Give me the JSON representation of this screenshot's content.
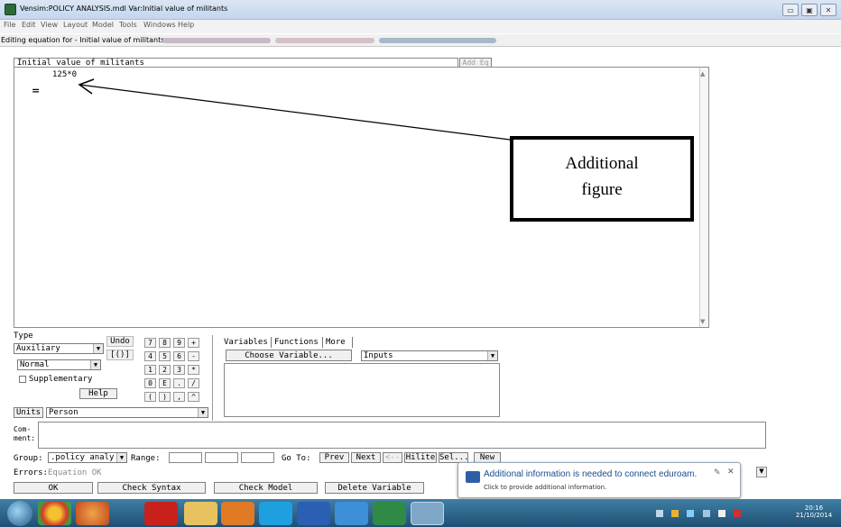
{
  "window": {
    "title": "Vensim:POLICY ANALYSIS.mdl Var:Initial value of militants",
    "controls": [
      "minimize",
      "maximize",
      "close"
    ]
  },
  "menu": [
    "File",
    "Edit",
    "View",
    "Layout",
    "Model",
    "Tools",
    "Windows",
    "Help"
  ],
  "edit_bar": {
    "label": "Editing equation for - Initial value of militants"
  },
  "equation": {
    "variable_name": "Initial value of militants",
    "add_eq_label": "Add Eq",
    "equals_sign": "=",
    "text": "125*0"
  },
  "annotation": {
    "line1": "Additional",
    "line2": "figure"
  },
  "type_panel": {
    "type_label": "Type",
    "type_value": "Auxiliary",
    "subtype_value": "Normal",
    "supplementary_label": "Supplementary",
    "supplementary_checked": false,
    "help_label": "Help",
    "undo_label": "Undo",
    "brackets_label": "[()]"
  },
  "keypad": [
    "7",
    "8",
    "9",
    "+",
    "4",
    "5",
    "6",
    "-",
    "1",
    "2",
    "3",
    "*",
    "0",
    "E",
    ".",
    "/",
    "(",
    ")",
    ",",
    "^"
  ],
  "variables_panel": {
    "tabs": [
      "Variables",
      "Functions",
      "More"
    ],
    "choose_label": "Choose Variable...",
    "inputs_value": "Inputs"
  },
  "units": {
    "label": "Units",
    "value": "Person"
  },
  "comment": {
    "label_line1": "Com-",
    "label_line2": "ment:",
    "value": ""
  },
  "group_row": {
    "group_label": "Group:",
    "group_value": ".policy analy",
    "range_label": "Range:",
    "goto_label": "Go To:",
    "prev_label": "Prev",
    "next_label": "Next",
    "back_label": "<--",
    "hilite_label": "Hilite",
    "sel_label": "Sel...",
    "new_label": "New"
  },
  "errors_row": {
    "label": "Errors:",
    "value": "Equation OK"
  },
  "bottom_buttons": {
    "ok": "OK",
    "check_syntax": "Check Syntax",
    "check_model": "Check Model",
    "delete_variable": "Delete Variable"
  },
  "notification": {
    "title": "Additional information is needed to connect eduroam.",
    "subtitle": "Click to provide additional information."
  },
  "taskbar": {
    "apps": [
      "start",
      "chrome",
      "firefox",
      "acrobat",
      "folder",
      "media",
      "skype",
      "word",
      "ie",
      "excel",
      "vensim"
    ],
    "time": "20:16",
    "date": "21/10/2014"
  },
  "colors": {
    "title_gradient_top": "#dbe6f4",
    "taskbar": "#2c6389",
    "notification_text": "#1a4c8e"
  }
}
